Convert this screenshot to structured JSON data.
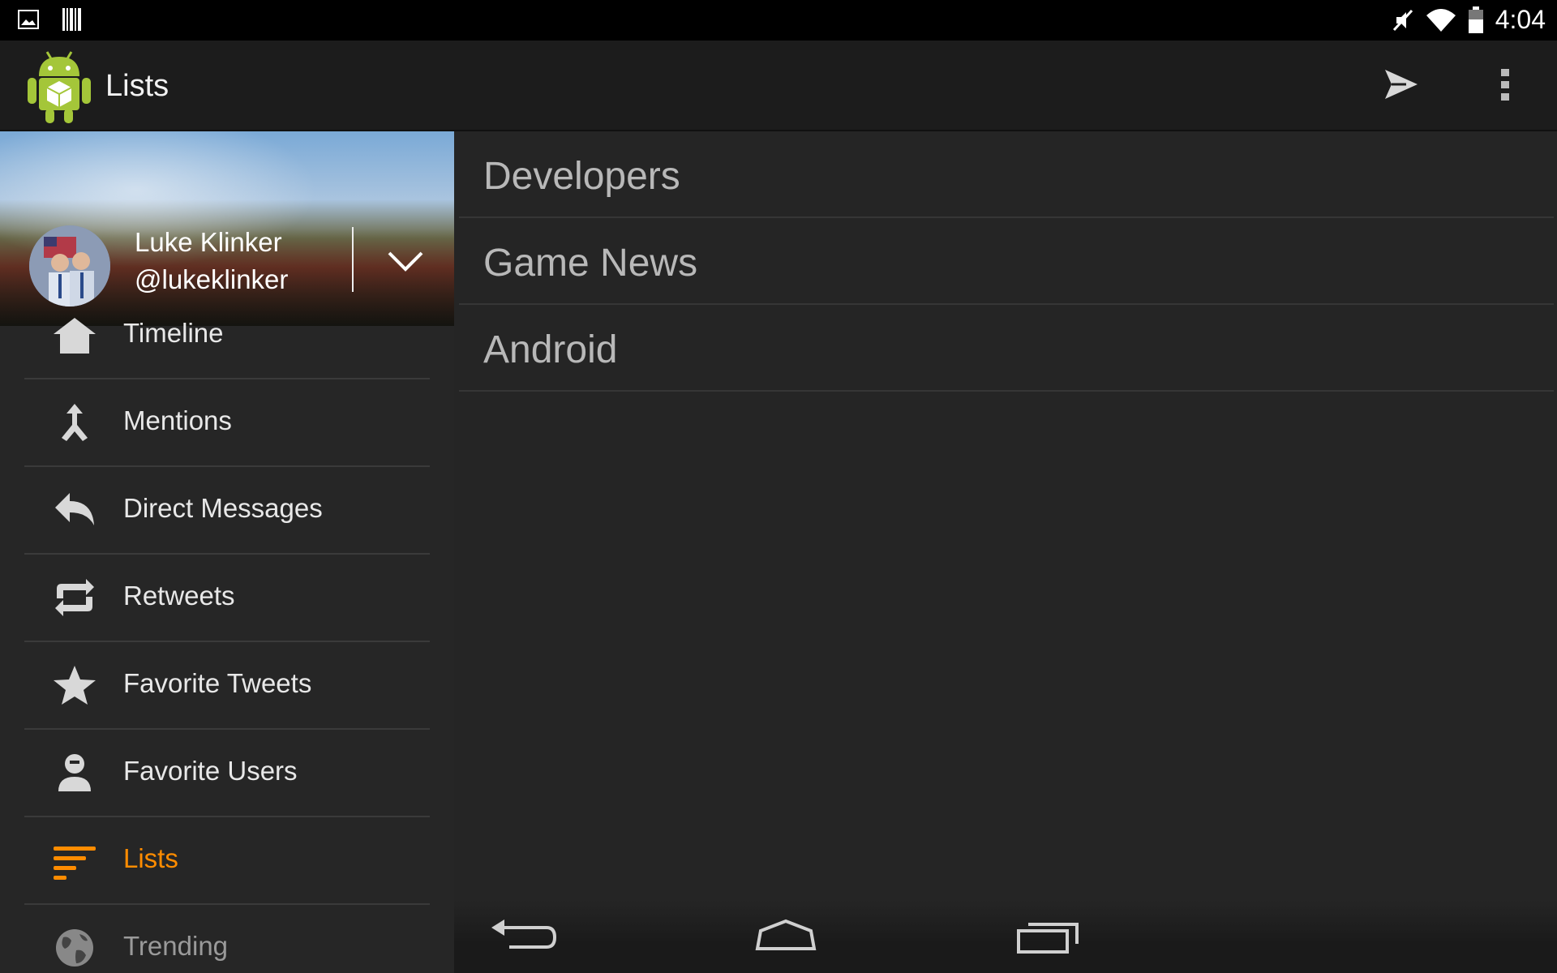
{
  "status_bar": {
    "time": "4:04",
    "left_icons": [
      "image-notification-icon",
      "barcode-notification-icon"
    ],
    "right_icons": [
      "mute-icon",
      "wifi-icon",
      "battery-icon"
    ]
  },
  "action_bar": {
    "title": "Lists",
    "logo_icon": "android-app-logo",
    "actions": [
      "send-icon",
      "overflow-menu-icon"
    ]
  },
  "drawer": {
    "user": {
      "name": "Luke Klinker",
      "handle": "@lukeklinker"
    },
    "items": [
      {
        "label": "Timeline",
        "icon": "home-icon"
      },
      {
        "label": "Mentions",
        "icon": "mentions-icon"
      },
      {
        "label": "Direct Messages",
        "icon": "reply-icon"
      },
      {
        "label": "Retweets",
        "icon": "retweet-icon"
      },
      {
        "label": "Favorite Tweets",
        "icon": "star-icon"
      },
      {
        "label": "Favorite Users",
        "icon": "user-icon"
      },
      {
        "label": "Lists",
        "icon": "lists-icon",
        "active": true
      },
      {
        "label": "Trending",
        "icon": "globe-icon"
      }
    ]
  },
  "lists": [
    {
      "name": "Developers"
    },
    {
      "name": "Game News"
    },
    {
      "name": "Android"
    }
  ],
  "colors": {
    "accent": "#ff8c00",
    "background": "#242424",
    "action_bar": "#1c1c1c"
  },
  "nav_bar": {
    "buttons": [
      "back-icon",
      "home-nav-icon",
      "recents-icon"
    ]
  }
}
